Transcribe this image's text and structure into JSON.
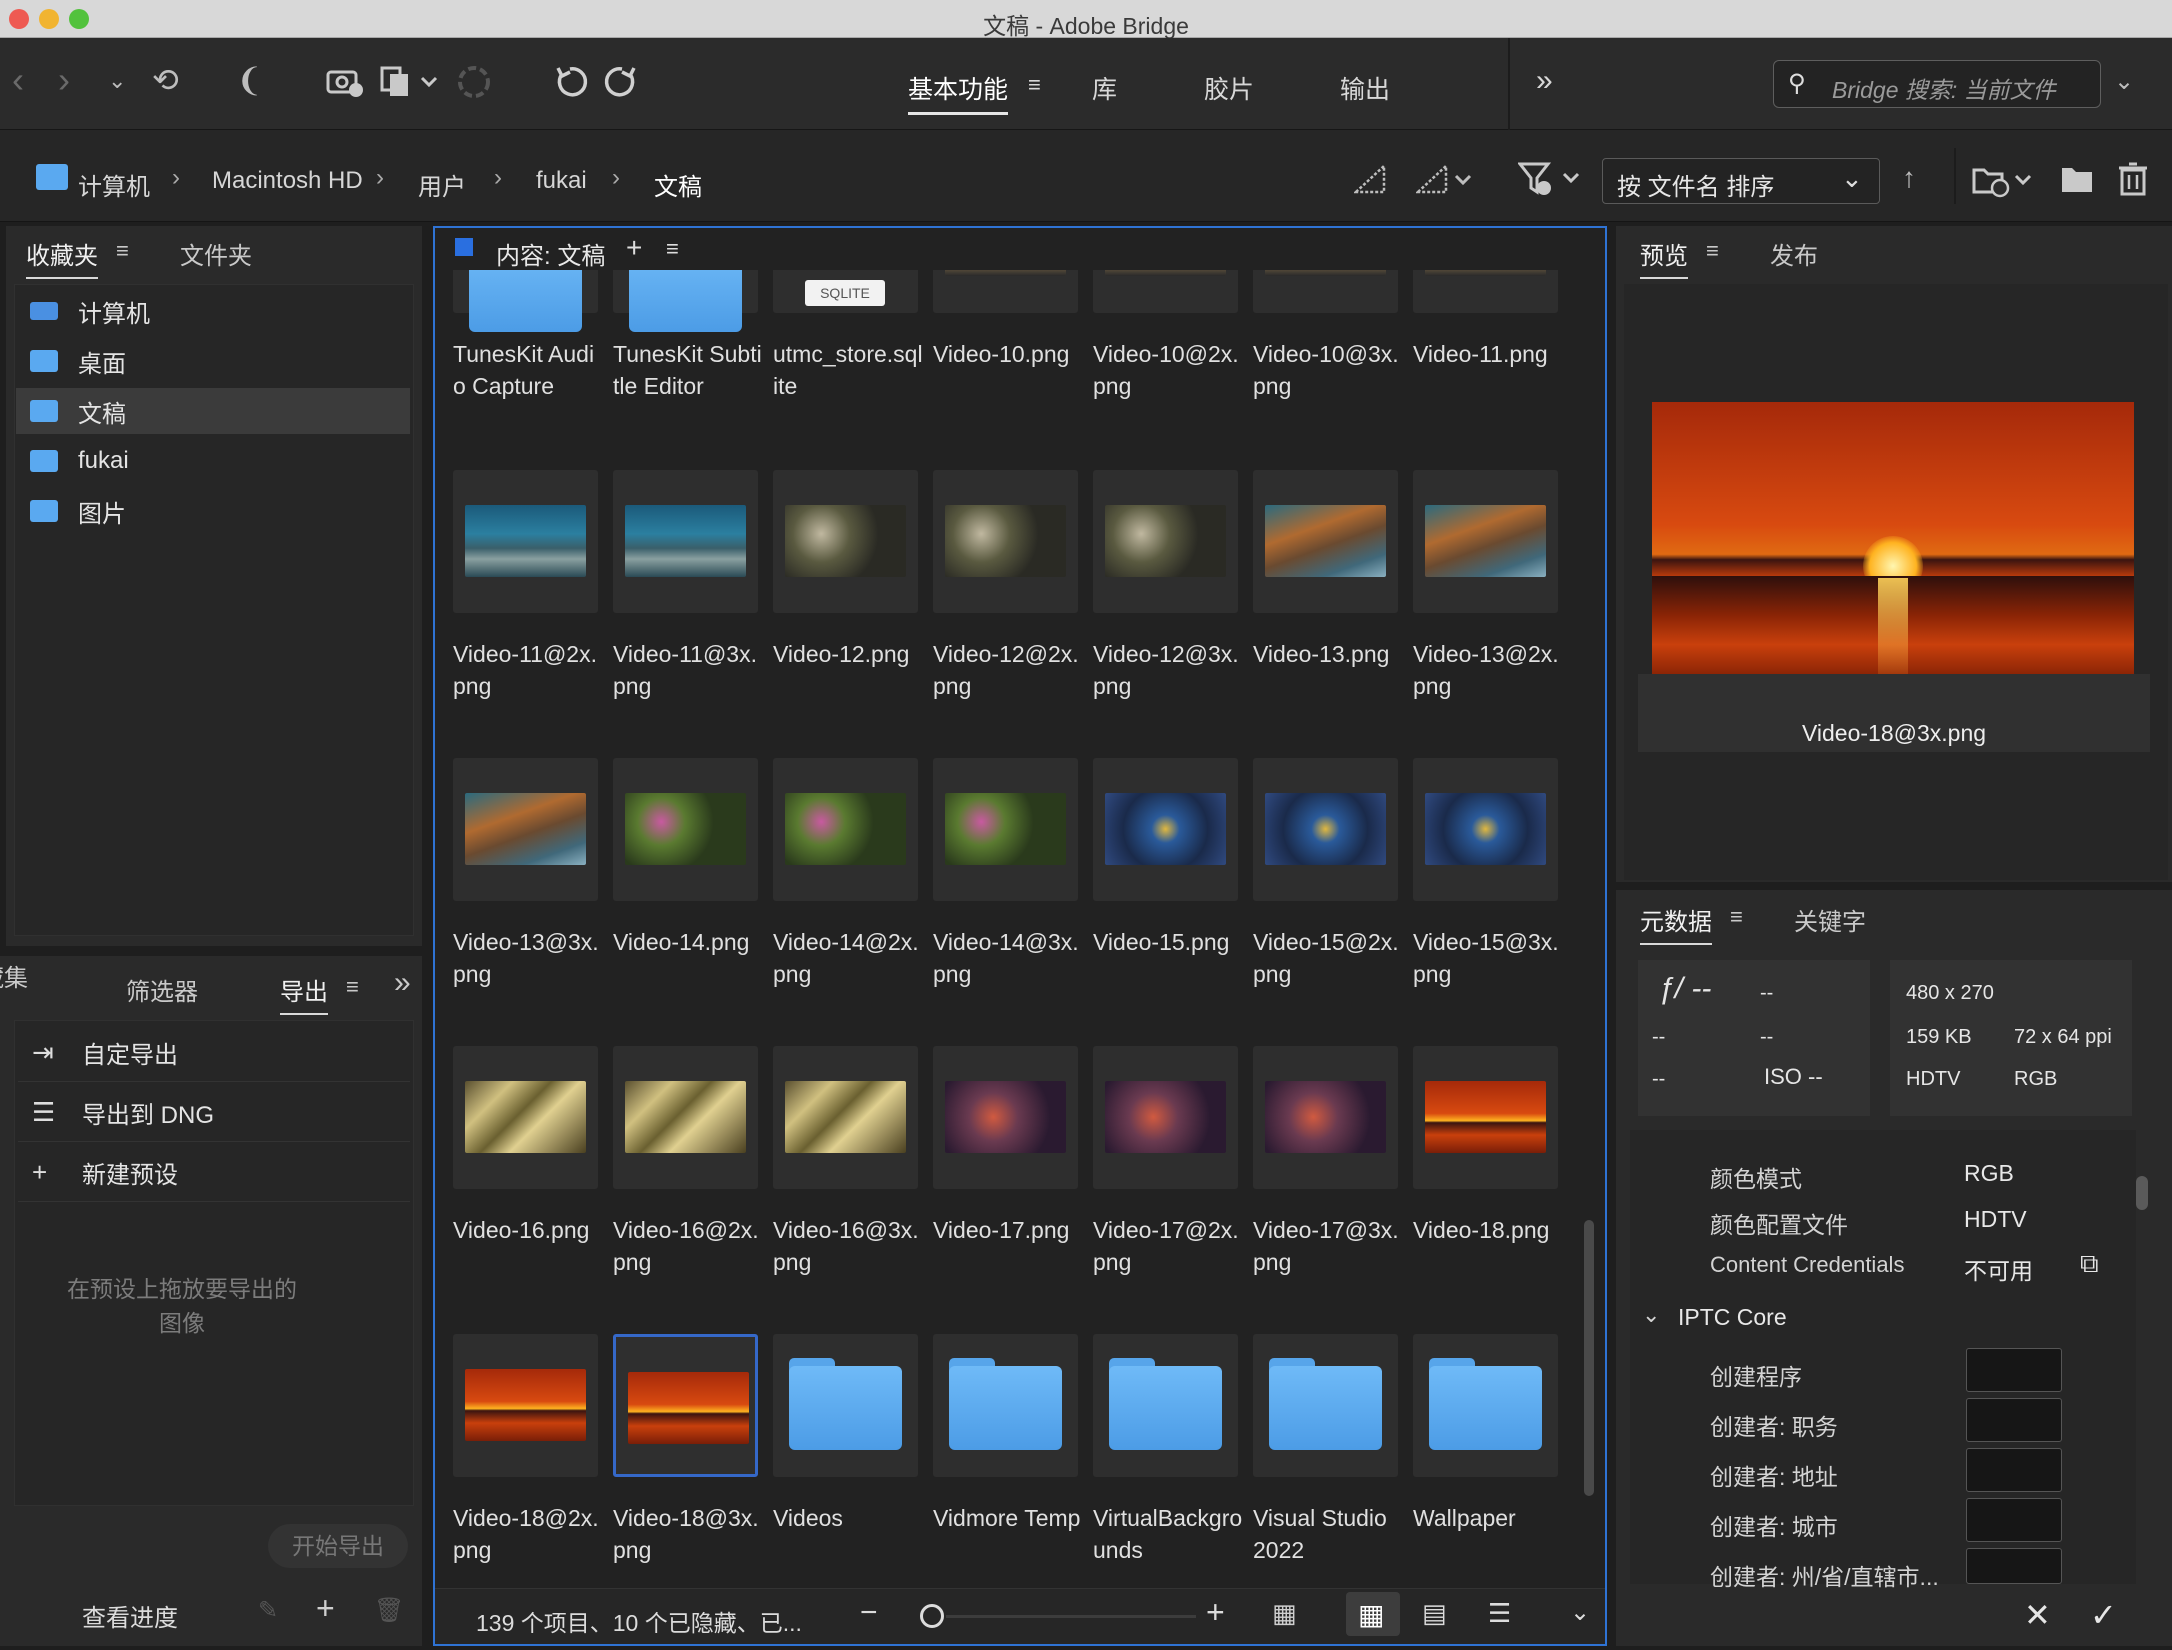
{
  "window": {
    "title": "文稿 - Adobe Bridge"
  },
  "toolbar": {
    "workspaces": [
      "基本功能",
      "库",
      "胶片",
      "输出"
    ],
    "more": "»",
    "search_placeholder": "Bridge 搜索: 当前文件"
  },
  "path": {
    "crumbs": [
      "计算机",
      "Macintosh HD",
      "用户",
      "fukai",
      "文稿"
    ],
    "sort_label": "按 文件名 排序"
  },
  "left_panel": {
    "tabs": [
      "收藏夹",
      "文件夹"
    ],
    "favorites": [
      "计算机",
      "桌面",
      "文稿",
      "fukai",
      "图片"
    ],
    "bottom_tabs": [
      "藏集",
      "筛选器",
      "导出"
    ],
    "export_items": [
      "自定导出",
      "导出到 DNG",
      "新建预设"
    ],
    "export_hint": "在预设上拖放要导出的图像",
    "start_export": "开始导出",
    "view_progress": "查看进度"
  },
  "content": {
    "header": "内容: 文稿",
    "items": [
      {
        "name": "TunesKit Audio Capture",
        "kind": "folder"
      },
      {
        "name": "TunesKit Subtitle Editor",
        "kind": "folder"
      },
      {
        "name": "utmc_store.sqlite",
        "kind": "sqlite",
        "badge": "SQLITE"
      },
      {
        "name": "Video-10.png",
        "kind": "partial"
      },
      {
        "name": "Video-10@2x.png",
        "kind": "partial"
      },
      {
        "name": "Video-10@3x.png",
        "kind": "partial"
      },
      {
        "name": "Video-11.png",
        "kind": "partial"
      },
      {
        "name": "Video-11@2x.png",
        "kind": "reef1"
      },
      {
        "name": "Video-11@3x.png",
        "kind": "reef1"
      },
      {
        "name": "Video-12.png",
        "kind": "reef2"
      },
      {
        "name": "Video-12@2x.png",
        "kind": "reef2"
      },
      {
        "name": "Video-12@3x.png",
        "kind": "reef2"
      },
      {
        "name": "Video-13.png",
        "kind": "reef3"
      },
      {
        "name": "Video-13@2x.png",
        "kind": "reef3"
      },
      {
        "name": "Video-13@3x.png",
        "kind": "reef3"
      },
      {
        "name": "Video-14.png",
        "kind": "flowers"
      },
      {
        "name": "Video-14@2x.png",
        "kind": "flowers"
      },
      {
        "name": "Video-14@3x.png",
        "kind": "flowers"
      },
      {
        "name": "Video-15.png",
        "kind": "blue"
      },
      {
        "name": "Video-15@2x.png",
        "kind": "blue"
      },
      {
        "name": "Video-15@3x.png",
        "kind": "blue"
      },
      {
        "name": "Video-16.png",
        "kind": "gold"
      },
      {
        "name": "Video-16@2x.png",
        "kind": "gold"
      },
      {
        "name": "Video-16@3x.png",
        "kind": "gold"
      },
      {
        "name": "Video-17.png",
        "kind": "fish"
      },
      {
        "name": "Video-17@2x.png",
        "kind": "fish"
      },
      {
        "name": "Video-17@3x.png",
        "kind": "fish"
      },
      {
        "name": "Video-18.png",
        "kind": "sunset"
      },
      {
        "name": "Video-18@2x.png",
        "kind": "sunset"
      },
      {
        "name": "Video-18@3x.png",
        "kind": "sunset",
        "selected": true
      },
      {
        "name": "Videos",
        "kind": "folder"
      },
      {
        "name": "Vidmore Temp",
        "kind": "folder"
      },
      {
        "name": "VirtualBackgrounds",
        "kind": "folder"
      },
      {
        "name": "Visual Studio 2022",
        "kind": "folder"
      },
      {
        "name": "Wallpaper",
        "kind": "folder"
      }
    ],
    "status": "139 个项目、10 个已隐藏、已..."
  },
  "preview": {
    "tabs": [
      "预览",
      "发布"
    ],
    "caption": "Video-18@3x.png"
  },
  "metadata": {
    "tabs": [
      "元数据",
      "关键字"
    ],
    "camera": {
      "aperture": "ƒ/ --",
      "a2": "--",
      "r2c1": "--",
      "r2c2": "--",
      "r3c1": "--",
      "iso": "ISO --"
    },
    "file": {
      "dimensions": "480 x 270",
      "size": "159 KB",
      "resolution": "72 x 64 ppi",
      "profile": "HDTV",
      "mode": "RGB"
    },
    "rows": [
      {
        "label": "颜色模式",
        "value": "RGB"
      },
      {
        "label": "颜色配置文件",
        "value": "HDTV"
      },
      {
        "label": "Content Credentials",
        "value": "不可用"
      }
    ],
    "section": "IPTC Core",
    "iptc_fields": [
      "创建程序",
      "创建者: 职务",
      "创建者: 地址",
      "创建者: 城市",
      "创建者: 州/省/直辖市..."
    ]
  }
}
